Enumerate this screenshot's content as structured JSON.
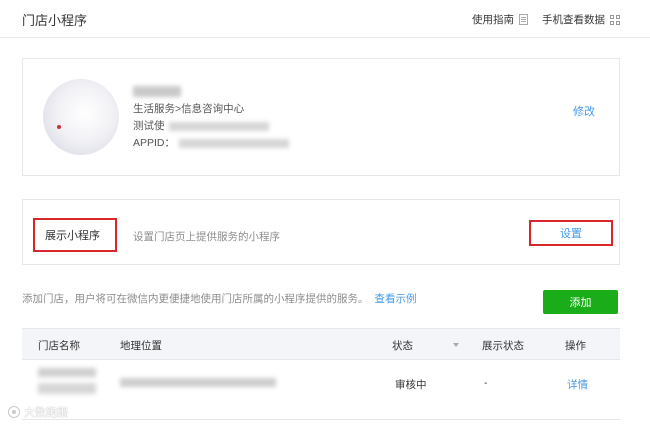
{
  "header": {
    "title": "门店小程序",
    "guide_label": "使用指南",
    "mobile_label": "手机查看数据"
  },
  "profile": {
    "category": "生活服务>信息咨询中心",
    "test_prefix": "测试使",
    "appid_label": "APPID：",
    "edit_label": "修改"
  },
  "show_section": {
    "label": "展示小程序",
    "description": "设置门店页上提供服务的小程序",
    "setting_label": "设置"
  },
  "notice": {
    "text": "添加门店，用户将可在微信内更便捷地使用门店所属的小程序提供的服务。",
    "example_label": "查看示例"
  },
  "add_button_label": "添加",
  "table": {
    "columns": [
      "门店名称",
      "地理位置",
      "状态",
      "展示状态",
      "操作"
    ],
    "rows": [
      {
        "status": "审核中",
        "display_status": "-",
        "action": "详情"
      }
    ]
  },
  "watermark": "大数跑跟",
  "colors": {
    "link": "#459ae9",
    "primary_button": "#1aad19",
    "highlight_border": "#d9262c"
  },
  "icons": [
    "guide-doc-icon",
    "qrcode-icon",
    "sort-caret-icon",
    "watermark-logo-icon"
  ]
}
